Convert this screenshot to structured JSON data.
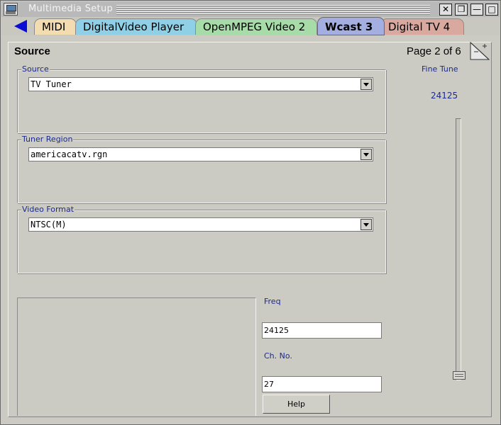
{
  "window": {
    "title": "Multimedia Setup",
    "controls": {
      "close": "✕",
      "restore": "❐",
      "minimize": "—",
      "maximize": "□"
    }
  },
  "tabs": [
    {
      "label": "MIDI",
      "color": "#f2dcb0",
      "active": false
    },
    {
      "label": "DigitalVideo Player",
      "color": "#8fd0e6",
      "active": false
    },
    {
      "label": "OpenMPEG Video 2",
      "color": "#a7dba8",
      "active": false
    },
    {
      "label": "Wcast 3",
      "color": "#a5aee0",
      "active": true
    },
    {
      "label": "Digital TV 4",
      "color": "#d9a89e",
      "active": false
    }
  ],
  "page": {
    "title": "Source",
    "indicator": "Page 2 of 6"
  },
  "groups": {
    "source": {
      "label": "Source",
      "value": "TV Tuner"
    },
    "tuner_region": {
      "label": "Tuner Region",
      "value": "americacatv.rgn"
    },
    "video_format": {
      "label": "Video Format",
      "value": "NTSC(M)"
    }
  },
  "fine_tune": {
    "label": "Fine Tune",
    "value": "24125",
    "slider_level": 0.0
  },
  "freq": {
    "label": "Freq",
    "value": "24125"
  },
  "channel": {
    "label": "Ch. No.",
    "value": "27"
  },
  "help_button": {
    "label": "Help"
  },
  "colors": {
    "label_blue": "#1c2a8c",
    "back_arrow": "#0b0bd6"
  }
}
